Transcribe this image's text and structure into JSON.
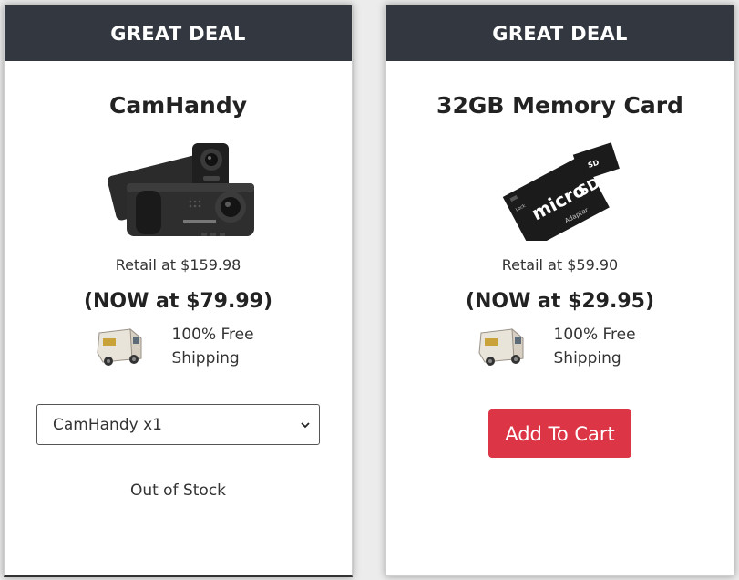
{
  "cards": [
    {
      "badge": "GREAT DEAL",
      "title": "CamHandy",
      "retail": "Retail at $159.98",
      "now": "(NOW at $79.99)",
      "shipping_line1": "100% Free",
      "shipping_line2": "Shipping",
      "select_value": "CamHandy x1",
      "status": "Out of Stock",
      "image_icon": "dashcam-image"
    },
    {
      "badge": "GREAT DEAL",
      "title": "32GB Memory Card",
      "retail": "Retail at $59.90",
      "now": "(NOW at $29.95)",
      "shipping_line1": "100% Free",
      "shipping_line2": "Shipping",
      "button_label": "Add To Cart",
      "image_icon": "microsd-card-image"
    }
  ],
  "colors": {
    "header_bg": "#323740",
    "button_bg": "#dc3545",
    "page_bg": "#ececec"
  }
}
